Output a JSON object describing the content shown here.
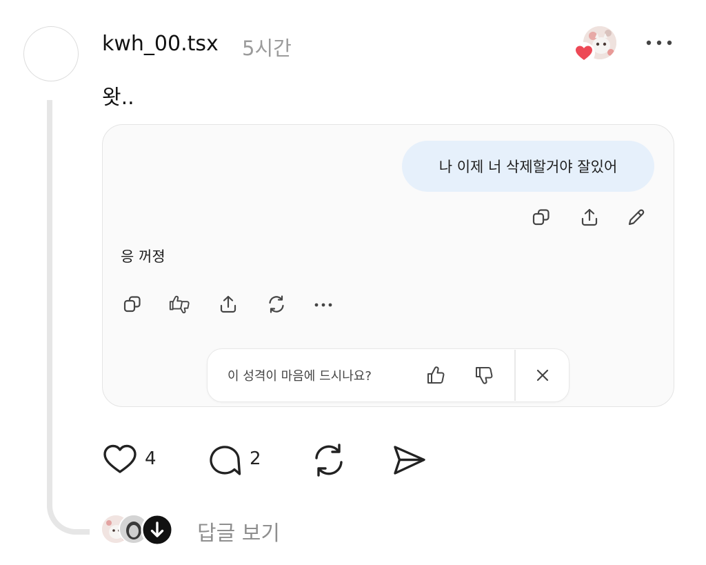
{
  "post": {
    "username": "kwh_00.tsx",
    "timestamp": "5시간",
    "text": "왓.."
  },
  "chat": {
    "user_message": "나 이제 너 삭제할거야 잘있어",
    "ai_reply": "응 꺼졍",
    "feedback_question": "이 성격이 마음에 드시나요?"
  },
  "actions": {
    "like_count": "4",
    "comment_count": "2"
  },
  "replies": {
    "label": "답글 보기"
  },
  "colors": {
    "heart": "#ed4956",
    "bubble": "#e6f0fb",
    "card_bg": "#fafafa",
    "muted_text": "#9b9b9b"
  },
  "icons": {
    "header": [
      "heart-icon",
      "more-icon"
    ],
    "user_message_actions": [
      "copy-icon",
      "share-icon",
      "edit-icon"
    ],
    "ai_reply_actions": [
      "copy-icon",
      "thumbs-up-down-icon",
      "share-icon",
      "regenerate-icon",
      "more-icon"
    ],
    "feedback": [
      "thumbs-up-icon",
      "thumbs-down-icon",
      "close-icon"
    ],
    "post_actions": [
      "heart-icon",
      "comment-icon",
      "repost-icon",
      "send-icon"
    ],
    "replies": [
      "arrow-down-icon"
    ]
  }
}
